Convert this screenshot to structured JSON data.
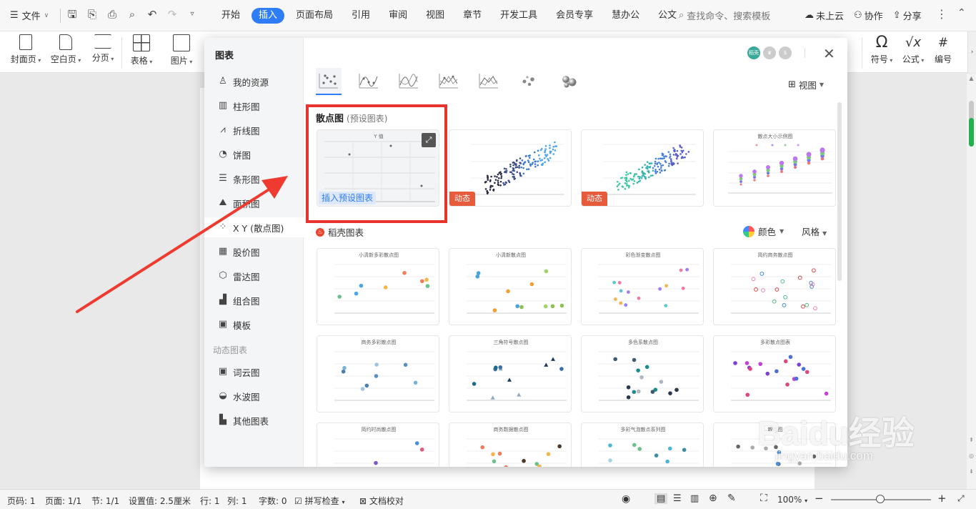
{
  "titlebar": {
    "file_label": "文件",
    "menus": [
      "开始",
      "插入",
      "页面布局",
      "引用",
      "审阅",
      "视图",
      "章节",
      "开发工具",
      "会员专享",
      "慧办公",
      "公文"
    ],
    "active_menu_index": 1,
    "search_placeholder": "查找命令、搜索模板",
    "cloud_label": "未上云",
    "collab_label": "协作",
    "share_label": "分享"
  },
  "ribbon": {
    "left": [
      {
        "label": "封面页",
        "icon": "cover-page-icon"
      },
      {
        "label": "空白页",
        "icon": "blank-page-icon"
      },
      {
        "label": "分页",
        "icon": "page-break-icon"
      },
      {
        "label": "表格",
        "icon": "table-icon"
      },
      {
        "label": "图片",
        "icon": "picture-icon"
      }
    ],
    "right": [
      {
        "label": "符号",
        "icon": "omega-icon"
      },
      {
        "label": "公式",
        "icon": "formula-icon"
      },
      {
        "label": "编号",
        "icon": "numbering-icon"
      }
    ]
  },
  "dialog": {
    "title": "图表",
    "sidebar": [
      {
        "label": "我的资源",
        "icon": "user-icon"
      },
      {
        "label": "柱形图",
        "icon": "column-chart-icon"
      },
      {
        "label": "折线图",
        "icon": "line-chart-icon"
      },
      {
        "label": "饼图",
        "icon": "pie-chart-icon"
      },
      {
        "label": "条形图",
        "icon": "bar-chart-icon"
      },
      {
        "label": "面积图",
        "icon": "area-chart-icon"
      },
      {
        "label": "X Y (散点图)",
        "icon": "scatter-chart-icon"
      },
      {
        "label": "股价图",
        "icon": "stock-chart-icon"
      },
      {
        "label": "雷达图",
        "icon": "radar-chart-icon"
      },
      {
        "label": "组合图",
        "icon": "combo-chart-icon"
      },
      {
        "label": "模板",
        "icon": "template-icon"
      }
    ],
    "active_sidebar_index": 6,
    "dynamic_group_label": "动态图表",
    "dynamic_items": [
      {
        "label": "词云图",
        "icon": "word-cloud-icon"
      },
      {
        "label": "水波图",
        "icon": "liquid-fill-icon"
      },
      {
        "label": "其他图表",
        "icon": "other-chart-icon"
      }
    ],
    "view_label": "视图",
    "preset_title": "散点图",
    "preset_sub": "(预设图表)",
    "insert_preset_label": "插入预设图表",
    "dynamic_tag": "动态",
    "daoke_title": "稻壳图表",
    "color_label": "颜色",
    "style_label": "风格",
    "badge_text": "稻壳",
    "preset_cards": [
      {
        "title": "Y 值",
        "dynamic": false
      },
      {
        "title": "",
        "dynamic": true
      },
      {
        "title": "",
        "dynamic": true
      },
      {
        "title": "散点大小示例图",
        "dynamic": false
      }
    ],
    "template_cards": [
      "小清新多彩散点图",
      "小清新散点图",
      "彩色渐变散点图",
      "简约商务散点图",
      "商务多彩散点图",
      "三角符号散点图",
      "多色系散点图",
      "多彩散点图表",
      "简约时尚散点图",
      "商务数据散点图",
      "多彩气泡散点系列图",
      "散点图"
    ]
  },
  "statusbar": {
    "page_no": "页码: 1",
    "page_count": "页面: 1/1",
    "section": "节: 1/1",
    "setting": "设置值: 2.5厘米",
    "row": "行: 1",
    "col": "列: 1",
    "word_count": "字数: 0",
    "spell_check": "拼写检查",
    "doc_check": "文档校对",
    "zoom": "100%"
  },
  "watermark": {
    "brand": "Baidu经验",
    "url": "jingyan.baidu.com"
  }
}
